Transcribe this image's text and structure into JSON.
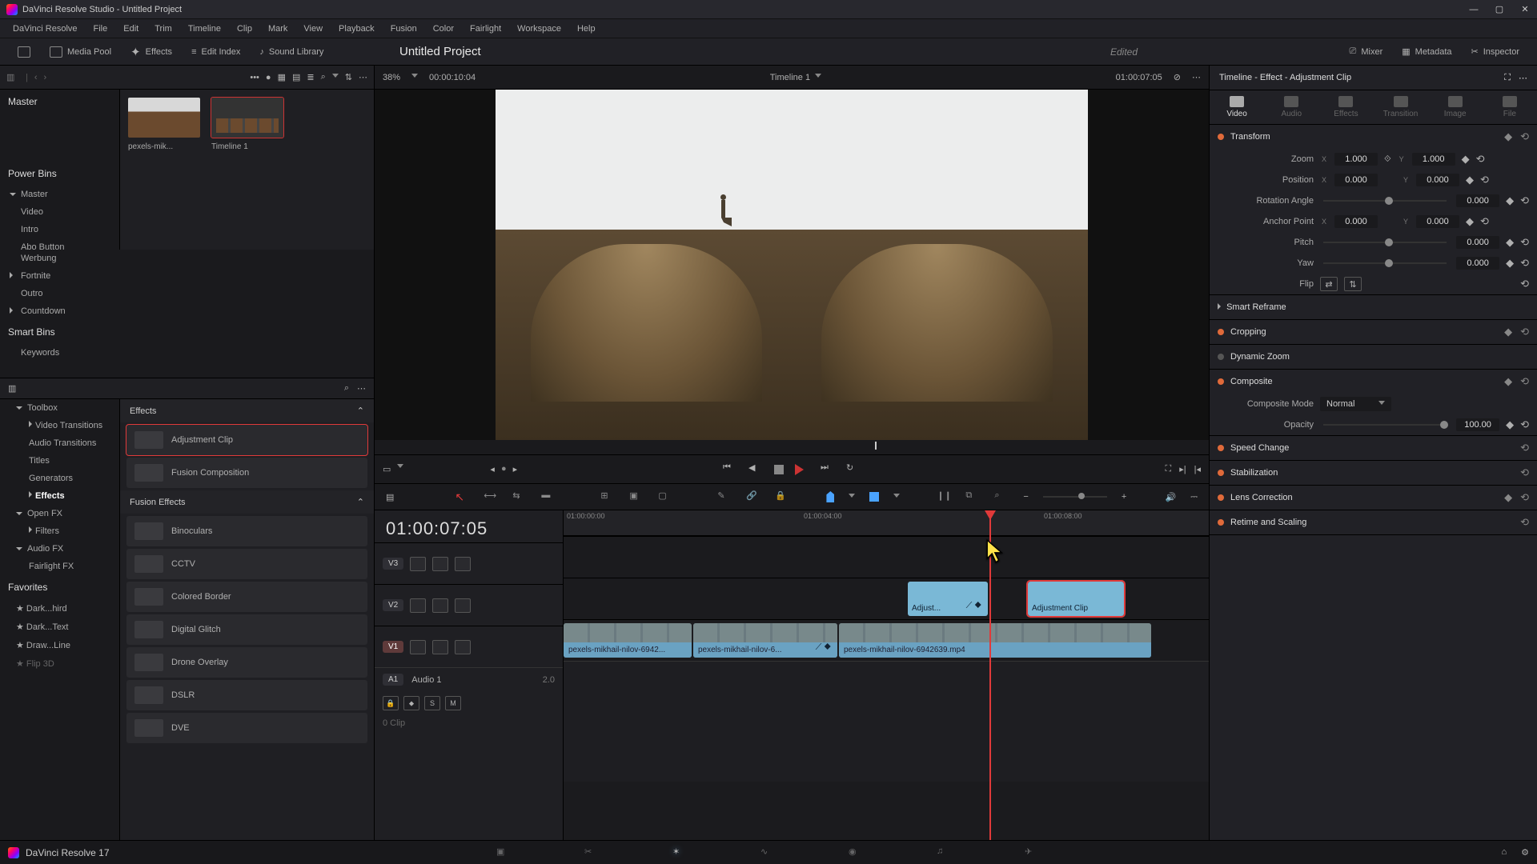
{
  "window": {
    "title": "DaVinci Resolve Studio - Untitled Project"
  },
  "menu": [
    "DaVinci Resolve",
    "File",
    "Edit",
    "Trim",
    "Timeline",
    "Clip",
    "Mark",
    "View",
    "Playback",
    "Fusion",
    "Color",
    "Fairlight",
    "Workspace",
    "Help"
  ],
  "toolbar": {
    "media_pool": "Media Pool",
    "effects": "Effects",
    "edit_index": "Edit Index",
    "sound_library": "Sound Library",
    "mixer": "Mixer",
    "metadata": "Metadata",
    "inspector": "Inspector"
  },
  "project": {
    "name": "Untitled Project",
    "status": "Edited"
  },
  "viewer": {
    "zoom": "38%",
    "left_tc": "00:00:10:04",
    "title": "Timeline 1",
    "right_tc": "01:00:07:05"
  },
  "media": {
    "master": "Master",
    "power_bins": "Power Bins",
    "pb_items": [
      "Master",
      "Video",
      "Intro",
      "Abo Button",
      "Werbung",
      "Fortnite",
      "Outro",
      "Countdown"
    ],
    "smart_bins": "Smart Bins",
    "sb_items": [
      "Keywords"
    ],
    "thumbs": [
      {
        "label": "pexels-mik..."
      },
      {
        "label": "Timeline 1"
      }
    ]
  },
  "fx_tree": {
    "toolbox": "Toolbox",
    "toolbox_items": [
      "Video Transitions",
      "Audio Transitions",
      "Titles",
      "Generators",
      "Effects"
    ],
    "openfx": "Open FX",
    "openfx_items": [
      "Filters"
    ],
    "audiofx": "Audio FX",
    "audiofx_items": [
      "Fairlight FX"
    ],
    "favorites": "Favorites",
    "fav_items": [
      "Dark...hird",
      "Dark...Text",
      "Draw...Line",
      "Flip 3D"
    ]
  },
  "fx_list": {
    "group1": "Effects",
    "items1": [
      "Adjustment Clip",
      "Fusion Composition"
    ],
    "group2": "Fusion Effects",
    "items2": [
      "Binoculars",
      "CCTV",
      "Colored Border",
      "Digital Glitch",
      "Drone Overlay",
      "DSLR",
      "DVE"
    ]
  },
  "timeline": {
    "tc": "01:00:07:05",
    "ruler": [
      "01:00:00:00",
      "01:00:04:00",
      "01:00:08:00"
    ],
    "tracks": {
      "v3": "V3",
      "v2": "V2",
      "v1": "V1",
      "a1": "A1",
      "a1_name": "Audio 1",
      "a1_ch": "2.0",
      "a1_sub": "0 Clip"
    },
    "clips": {
      "c1": "pexels-mikhail-nilov-6942...",
      "c2": "pexels-mikhail-nilov-6...",
      "c3": "pexels-mikhail-nilov-6942639.mp4",
      "adj1": "Adjust...",
      "adj2": "Adjustment Clip"
    },
    "solo": "S",
    "mute": "M"
  },
  "inspector": {
    "title": "Timeline - Effect - Adjustment Clip",
    "tabs": [
      "Video",
      "Audio",
      "Effects",
      "Transition",
      "Image",
      "File"
    ],
    "transform": "Transform",
    "zoom_lbl": "Zoom",
    "zoom_x": "1.000",
    "zoom_y": "1.000",
    "pos_lbl": "Position",
    "pos_x": "0.000",
    "pos_y": "0.000",
    "rot_lbl": "Rotation Angle",
    "rot": "0.000",
    "anchor_lbl": "Anchor Point",
    "anchor_x": "0.000",
    "anchor_y": "0.000",
    "pitch_lbl": "Pitch",
    "pitch": "0.000",
    "yaw_lbl": "Yaw",
    "yaw": "0.000",
    "flip_lbl": "Flip",
    "smart_reframe": "Smart Reframe",
    "cropping": "Cropping",
    "dyn_zoom": "Dynamic Zoom",
    "composite": "Composite",
    "comp_mode_lbl": "Composite Mode",
    "comp_mode": "Normal",
    "opacity_lbl": "Opacity",
    "opacity": "100.00",
    "speed": "Speed Change",
    "stab": "Stabilization",
    "lens": "Lens Correction",
    "retime": "Retime and Scaling"
  },
  "footer": {
    "version": "DaVinci Resolve 17"
  }
}
